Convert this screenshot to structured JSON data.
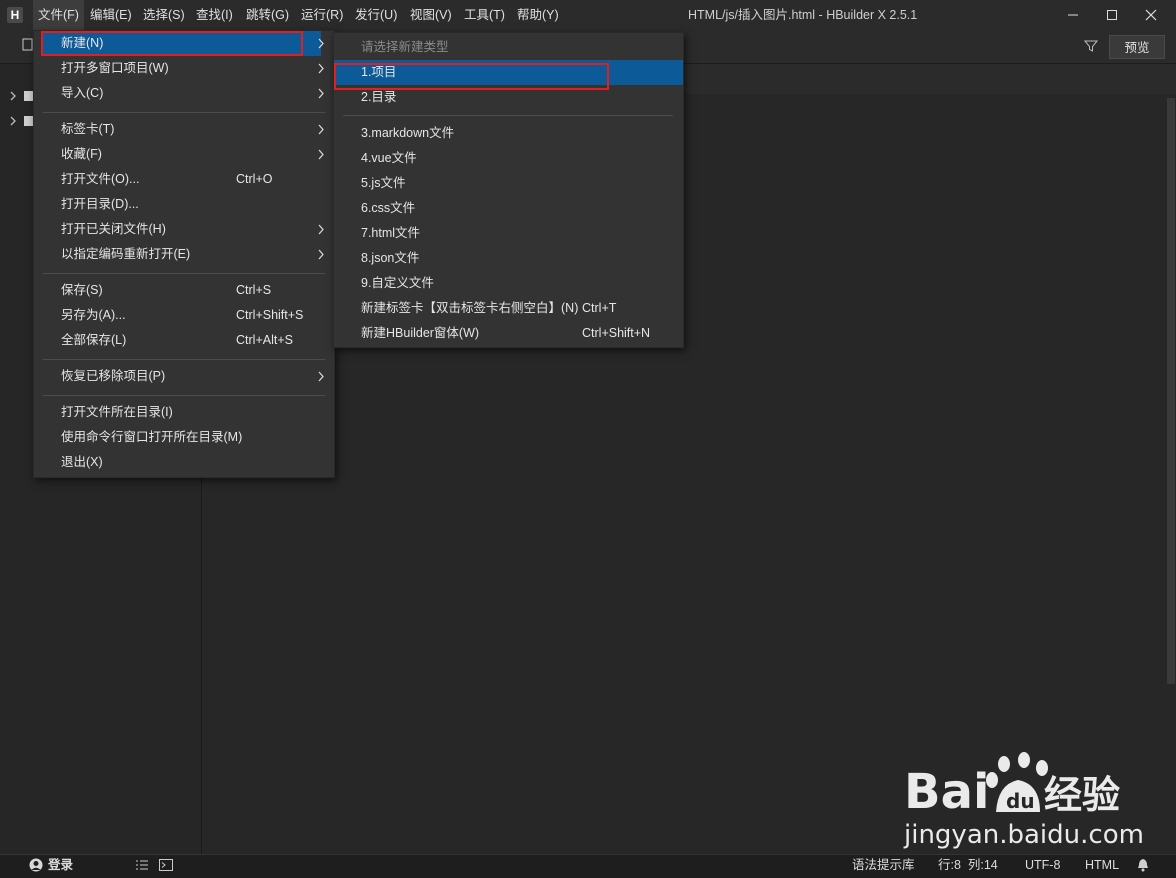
{
  "window": {
    "title": "HTML/js/插入图片.html - HBuilder X 2.5.1",
    "logo_text": "H"
  },
  "menubar": [
    {
      "label": "文件(F)"
    },
    {
      "label": "编辑(E)"
    },
    {
      "label": "选择(S)"
    },
    {
      "label": "查找(I)"
    },
    {
      "label": "跳转(G)"
    },
    {
      "label": "运行(R)"
    },
    {
      "label": "发行(U)"
    },
    {
      "label": "视图(V)"
    },
    {
      "label": "工具(T)"
    },
    {
      "label": "帮助(Y)"
    }
  ],
  "toolbar": {
    "preview_label": "预览"
  },
  "file_menu": {
    "items": [
      {
        "label": "新建(N)",
        "shortcut": "",
        "submenu": true,
        "highlighted": true
      },
      {
        "label": "打开多窗口项目(W)",
        "shortcut": "",
        "submenu": true
      },
      {
        "label": "导入(C)",
        "shortcut": "",
        "submenu": true
      },
      {
        "label": "标签卡(T)",
        "shortcut": "",
        "submenu": true
      },
      {
        "label": "收藏(F)",
        "shortcut": "",
        "submenu": true
      },
      {
        "label": "打开文件(O)...",
        "shortcut": "Ctrl+O",
        "submenu": false
      },
      {
        "label": "打开目录(D)...",
        "shortcut": "",
        "submenu": false
      },
      {
        "label": "打开已关闭文件(H)",
        "shortcut": "",
        "submenu": true
      },
      {
        "label": "以指定编码重新打开(E)",
        "shortcut": "",
        "submenu": true
      },
      {
        "label": "保存(S)",
        "shortcut": "Ctrl+S",
        "submenu": false
      },
      {
        "label": "另存为(A)...",
        "shortcut": "Ctrl+Shift+S",
        "submenu": false
      },
      {
        "label": "全部保存(L)",
        "shortcut": "Ctrl+Alt+S",
        "submenu": false
      },
      {
        "label": "恢复已移除项目(P)",
        "shortcut": "",
        "submenu": true
      },
      {
        "label": "打开文件所在目录(I)",
        "shortcut": "",
        "submenu": false
      },
      {
        "label": "使用命令行窗口打开所在目录(M)",
        "shortcut": "",
        "submenu": false
      },
      {
        "label": "退出(X)",
        "shortcut": "",
        "submenu": false
      }
    ]
  },
  "new_submenu": {
    "header": "请选择新建类型",
    "items": [
      {
        "label": "1.项目",
        "shortcut": "",
        "highlighted": true
      },
      {
        "label": "2.目录",
        "shortcut": ""
      },
      {
        "label": "3.markdown文件",
        "shortcut": ""
      },
      {
        "label": "4.vue文件",
        "shortcut": ""
      },
      {
        "label": "5.js文件",
        "shortcut": ""
      },
      {
        "label": "6.css文件",
        "shortcut": ""
      },
      {
        "label": "7.html文件",
        "shortcut": ""
      },
      {
        "label": "8.json文件",
        "shortcut": ""
      },
      {
        "label": "9.自定义文件",
        "shortcut": ""
      },
      {
        "label": "新建标签卡【双击标签卡右侧空白】(N)",
        "shortcut": "Ctrl+T"
      },
      {
        "label": "新建HBuilder窗体(W)",
        "shortcut": "Ctrl+Shift+N"
      }
    ]
  },
  "statusbar": {
    "login": "登录",
    "syntax_lib": "语法提示库",
    "position": "行:8  列:14",
    "encoding": "UTF-8",
    "language": "HTML"
  },
  "watermark": {
    "brand": "Bai",
    "brand2": "经验",
    "url": "jingyan.baidu.com"
  },
  "colors": {
    "highlight": "#0d5a99",
    "annotation_box": "#e02020"
  }
}
